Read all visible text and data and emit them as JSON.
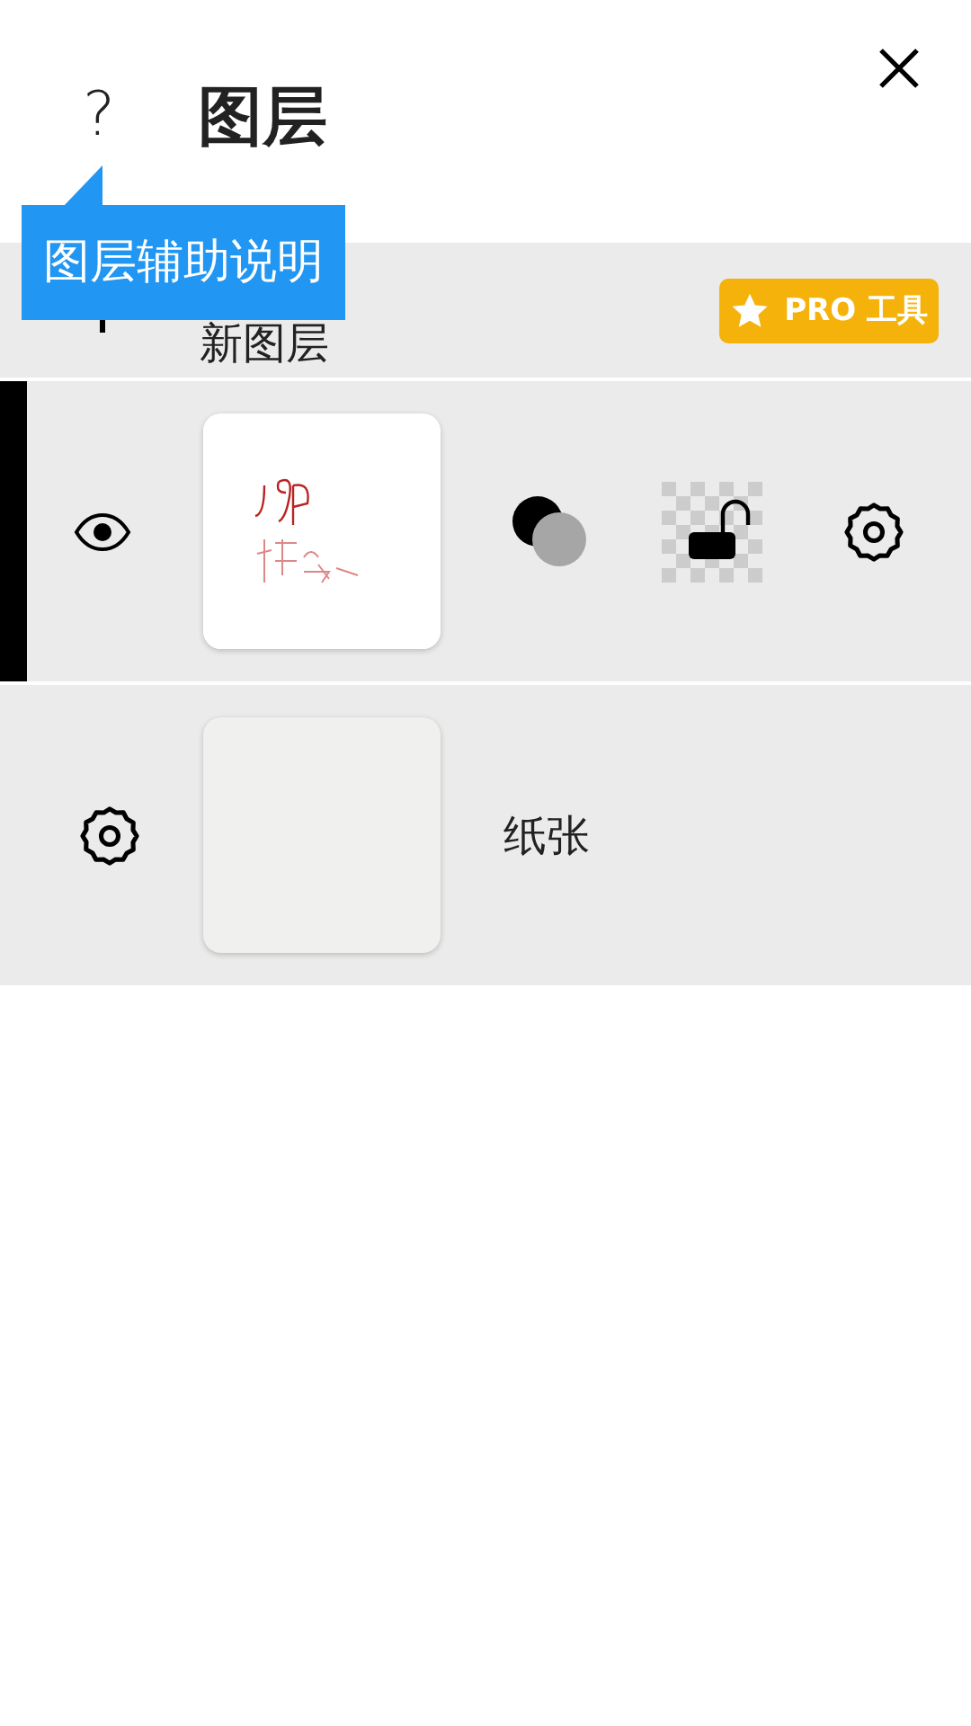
{
  "header": {
    "help": "?",
    "title": "图层"
  },
  "tooltip": {
    "text": "图层辅助说明"
  },
  "new_layer": {
    "label": "新图层",
    "badge": "PRO 工具"
  },
  "layers": [
    {
      "kind": "drawing",
      "selected": true,
      "visible": true,
      "locked": false
    },
    {
      "kind": "paper",
      "selected": false,
      "label": "纸张"
    }
  ]
}
